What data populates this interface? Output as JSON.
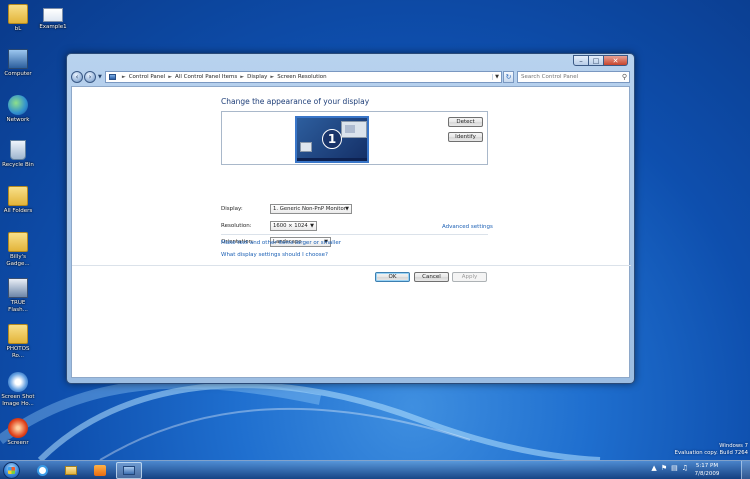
{
  "desktop": {
    "icons": [
      {
        "label": "bL",
        "icon": "folder-icon"
      },
      {
        "label": "Example1",
        "icon": "document-icon"
      },
      {
        "label": "Computer",
        "icon": "computer-icon"
      },
      {
        "label": "Network",
        "icon": "network-icon"
      },
      {
        "label": "Recycle Bin",
        "icon": "recycle-bin-icon"
      },
      {
        "label": "All Folders",
        "icon": "folder-icon"
      },
      {
        "label": "Billy's Gadge...",
        "icon": "folder-icon"
      },
      {
        "label": "TRUE Flash...",
        "icon": "app-icon"
      },
      {
        "label": "PHOTOS Ro...",
        "icon": "folder-icon"
      },
      {
        "label": "Screen Shot Image Ho...",
        "icon": "app-icon"
      },
      {
        "label": "Screenr",
        "icon": "app-icon"
      }
    ]
  },
  "window": {
    "breadcrumb": [
      "Control Panel",
      "All Control Panel Items",
      "Display",
      "Screen Resolution"
    ],
    "search_placeholder": "Search Control Panel",
    "heading": "Change the appearance of your display",
    "monitor_number": "1",
    "detect_label": "Detect",
    "identify_label": "Identify",
    "display_label": "Display:",
    "display_value": "1. Generic Non-PnP Monitor",
    "resolution_label": "Resolution:",
    "resolution_value": "1600 × 1024",
    "orientation_label": "Orientation:",
    "orientation_value": "Landscape",
    "advanced_link": "Advanced settings",
    "link_text_size": "Make text and other items larger or smaller",
    "link_settings": "What display settings should I choose?",
    "ok_label": "OK",
    "cancel_label": "Cancel",
    "apply_label": "Apply"
  },
  "taskbar": {
    "time": "5:17 PM",
    "date": "7/8/2009"
  },
  "watermark": {
    "line1": "Windows 7",
    "line2": "Evaluation copy. Build 7264"
  }
}
